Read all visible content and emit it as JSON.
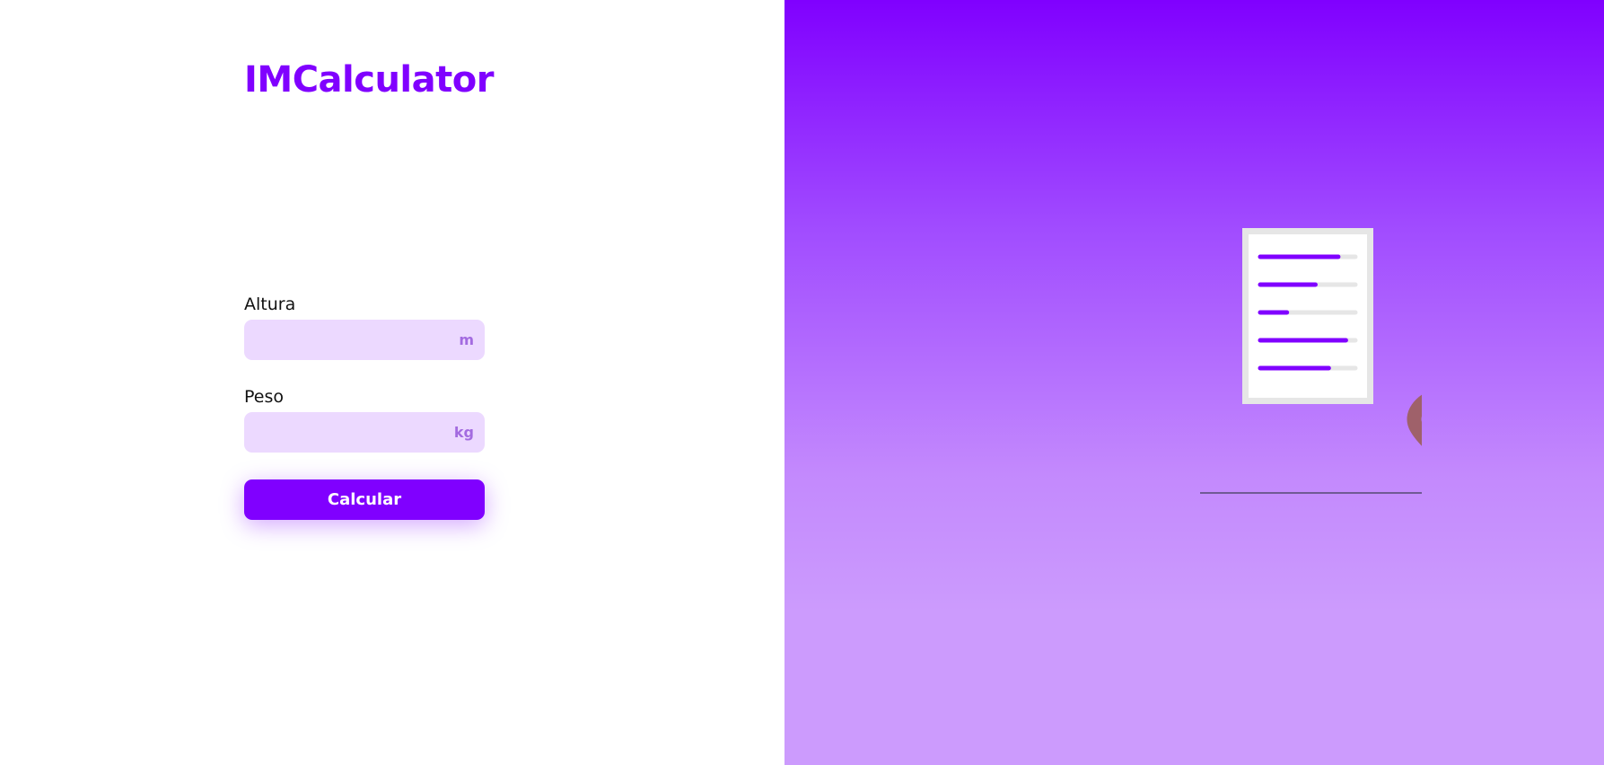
{
  "app": {
    "title": "IMCalculator"
  },
  "form": {
    "height": {
      "label": "Altura",
      "value": "",
      "unit": "m"
    },
    "weight": {
      "label": "Peso",
      "value": "",
      "unit": "kg"
    },
    "submit_label": "Calcular"
  },
  "illustration": {
    "icon": "runner-with-checklist-illustration",
    "accent_color": "#8000ff",
    "checklist_progress": [
      0.82,
      0.58,
      0.28,
      0.9,
      0.72
    ]
  },
  "colors": {
    "brand": "#8000ff",
    "input_background": "#ecd9ff",
    "unit_text": "#a36be0",
    "gradient_top": "#8000ff",
    "gradient_bottom": "#cc9bfd"
  }
}
